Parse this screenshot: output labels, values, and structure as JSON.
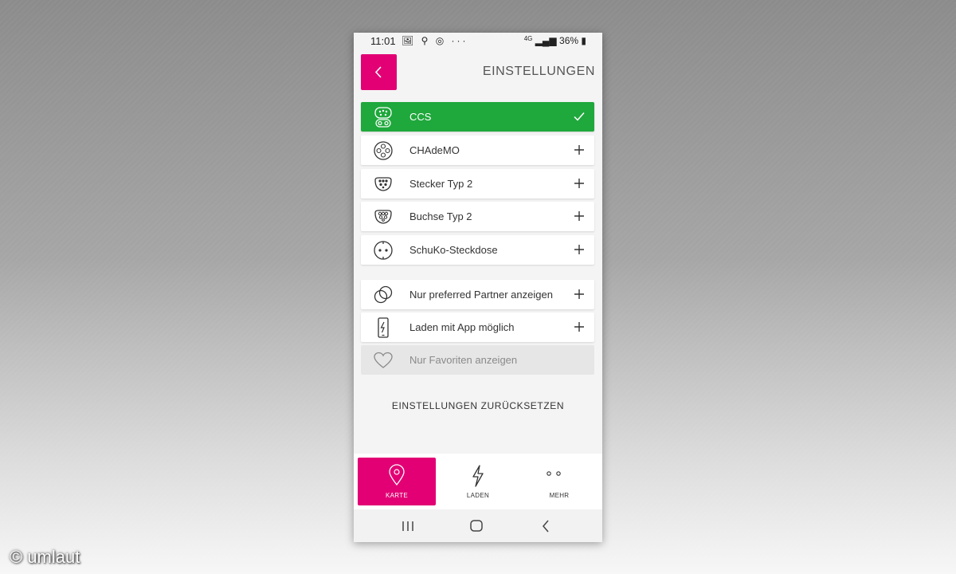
{
  "status_bar": {
    "time": "11:01",
    "icons": "🖼 ⚲ ◎ ···",
    "network": "4G",
    "battery": "36%"
  },
  "header": {
    "title": "EINSTELLUNGEN"
  },
  "connectors": [
    {
      "label": "CCS",
      "icon": "ccs-plug-icon",
      "selected": true
    },
    {
      "label": "CHAdeMO",
      "icon": "chademo-plug-icon",
      "selected": false
    },
    {
      "label": "Stecker Typ 2",
      "icon": "type2-plug-icon",
      "selected": false
    },
    {
      "label": "Buchse Typ 2",
      "icon": "type2-socket-icon",
      "selected": false
    },
    {
      "label": "SchuKo-Steckdose",
      "icon": "schuko-socket-icon",
      "selected": false
    }
  ],
  "filters": [
    {
      "label": "Nur preferred Partner anzeigen",
      "icon": "partner-rings-icon",
      "enabled": true
    },
    {
      "label": "Laden mit App möglich",
      "icon": "phone-charge-icon",
      "enabled": true
    },
    {
      "label": "Nur Favoriten anzeigen",
      "icon": "heart-icon",
      "enabled": false
    }
  ],
  "reset_label": "EINSTELLUNGEN ZURÜCKSETZEN",
  "bottom_nav": [
    {
      "label": "KARTE",
      "icon": "map-pin-icon",
      "active": true
    },
    {
      "label": "LADEN",
      "icon": "lightning-icon",
      "active": false
    },
    {
      "label": "MEHR",
      "icon": "more-dots-icon",
      "active": false
    }
  ],
  "colors": {
    "brand_magenta": "#e20074",
    "selected_green": "#1fa83c",
    "background": "#f4f4f4"
  },
  "watermark": "© umlaut"
}
